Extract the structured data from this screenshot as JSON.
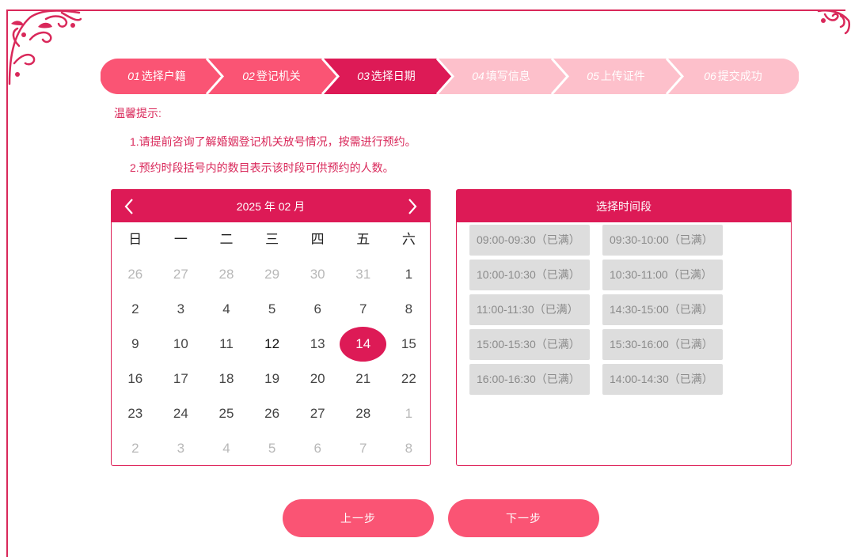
{
  "steps": [
    {
      "num": "01",
      "label": "选择户籍",
      "state": "done"
    },
    {
      "num": "02",
      "label": "登记机关",
      "state": "done"
    },
    {
      "num": "03",
      "label": "选择日期",
      "state": "active"
    },
    {
      "num": "04",
      "label": "填写信息",
      "state": "pending"
    },
    {
      "num": "05",
      "label": "上传证件",
      "state": "pending"
    },
    {
      "num": "06",
      "label": "提交成功",
      "state": "pending"
    }
  ],
  "tips": {
    "title": "温馨提示:",
    "line1": "1.请提前咨询了解婚姻登记机关放号情况，按需进行预约。",
    "line2": "2.预约时段括号内的数目表示该时段可供预约的人数。"
  },
  "calendar": {
    "month_label": "2025 年 02 月",
    "weekdays": [
      "日",
      "一",
      "二",
      "三",
      "四",
      "五",
      "六"
    ],
    "days": [
      {
        "d": "26",
        "other": true
      },
      {
        "d": "27",
        "other": true
      },
      {
        "d": "28",
        "other": true
      },
      {
        "d": "29",
        "other": true
      },
      {
        "d": "30",
        "other": true
      },
      {
        "d": "31",
        "other": true
      },
      {
        "d": "1"
      },
      {
        "d": "2"
      },
      {
        "d": "3"
      },
      {
        "d": "4"
      },
      {
        "d": "5"
      },
      {
        "d": "6"
      },
      {
        "d": "7"
      },
      {
        "d": "8"
      },
      {
        "d": "9"
      },
      {
        "d": "10"
      },
      {
        "d": "11"
      },
      {
        "d": "12",
        "today": true
      },
      {
        "d": "13"
      },
      {
        "d": "14",
        "selected": true
      },
      {
        "d": "15"
      },
      {
        "d": "16"
      },
      {
        "d": "17"
      },
      {
        "d": "18"
      },
      {
        "d": "19"
      },
      {
        "d": "20"
      },
      {
        "d": "21"
      },
      {
        "d": "22"
      },
      {
        "d": "23"
      },
      {
        "d": "24"
      },
      {
        "d": "25"
      },
      {
        "d": "26"
      },
      {
        "d": "27"
      },
      {
        "d": "28"
      },
      {
        "d": "1",
        "other": true
      },
      {
        "d": "2",
        "other": true
      },
      {
        "d": "3",
        "other": true
      },
      {
        "d": "4",
        "other": true
      },
      {
        "d": "5",
        "other": true
      },
      {
        "d": "6",
        "other": true
      },
      {
        "d": "7",
        "other": true
      },
      {
        "d": "8",
        "other": true
      }
    ]
  },
  "slots": {
    "title": "选择时间段",
    "items": [
      "09:00-09:30（已满）",
      "09:30-10:00（已满）",
      "10:00-10:30（已满）",
      "10:30-11:00（已满）",
      "11:00-11:30（已满）",
      "14:30-15:00（已满）",
      "15:00-15:30（已满）",
      "15:30-16:00（已满）",
      "16:00-16:30（已满）",
      "14:00-14:30（已满）"
    ]
  },
  "buttons": {
    "prev": "上一步",
    "next": "下一步"
  },
  "colors": {
    "accent": "#dd1a56",
    "step_done": "#fa5474",
    "step_pending": "#fdc0cb",
    "button": "#fa5474"
  }
}
